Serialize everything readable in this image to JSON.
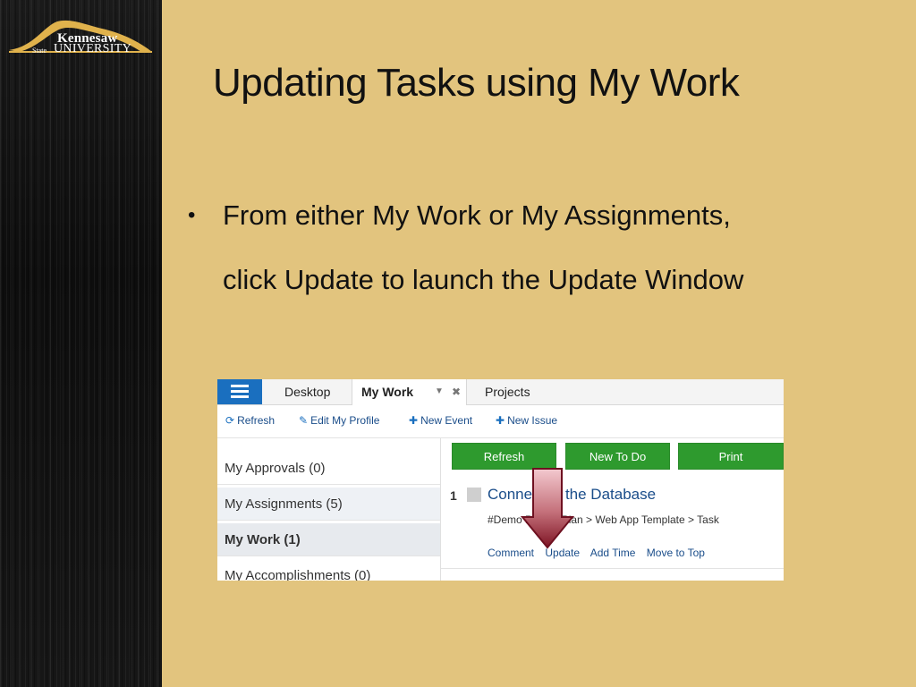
{
  "logo": {
    "line1": "Kennesaw",
    "line2": "State",
    "line3": "UNIVERSITY"
  },
  "slide": {
    "title": "Updating Tasks using My Work",
    "bullet_marker": "•",
    "bullet_line1": "From either My Work or My Assignments,",
    "bullet_line2": "click Update to launch the Update Window"
  },
  "screenshot": {
    "tabs": {
      "desktop": "Desktop",
      "my_work": "My Work",
      "projects": "Projects"
    },
    "toolbar": {
      "refresh": "Refresh",
      "edit_profile": "Edit My Profile",
      "new_event": "New Event",
      "new_issue": "New Issue"
    },
    "nav": {
      "approvals": "My Approvals (0)",
      "assignments": "My Assignments (5)",
      "my_work": "My Work (1)",
      "accomplishments": "My Accomplishments (0)"
    },
    "buttons": {
      "refresh": "Refresh",
      "new_todo": "New To Do",
      "print": "Print"
    },
    "task": {
      "number": "1",
      "title": "Connect to the Database",
      "path": "#Demo Project Plan > Web App Template > Task",
      "actions": {
        "comment": "Comment",
        "update": "Update",
        "add_time": "Add Time",
        "move_top": "Move to Top"
      }
    }
  },
  "colors": {
    "slide_bg": "#e2c47e",
    "accent_blue": "#1a6fbf",
    "button_green": "#2e9a2e",
    "arrow_red": "#8e1a2a"
  }
}
